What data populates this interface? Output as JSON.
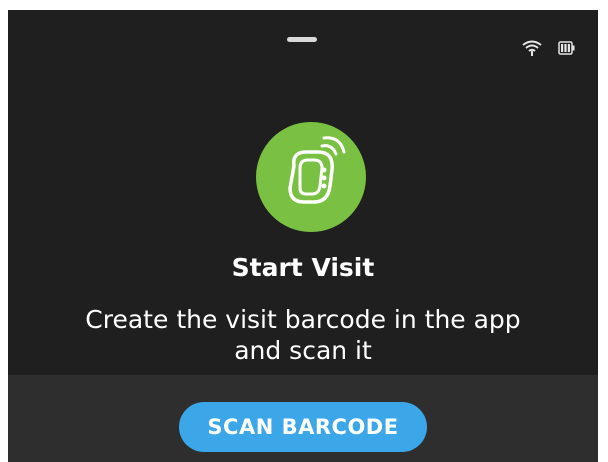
{
  "status_bar": {
    "icons": [
      "wifi-icon",
      "battery-icon"
    ]
  },
  "app_icon": {
    "name": "wearable-device-icon",
    "background": "#7ac143"
  },
  "main": {
    "title": "Start Visit",
    "subtitle_line1": "Create the visit barcode in the app",
    "subtitle_line2": "and scan it"
  },
  "actions": {
    "scan_button_label": "SCAN BARCODE",
    "scan_button_color": "#3ba7e8"
  },
  "colors": {
    "background": "#1f1f1f",
    "bottom_bar": "#2e2e2e",
    "text": "#ffffff"
  }
}
